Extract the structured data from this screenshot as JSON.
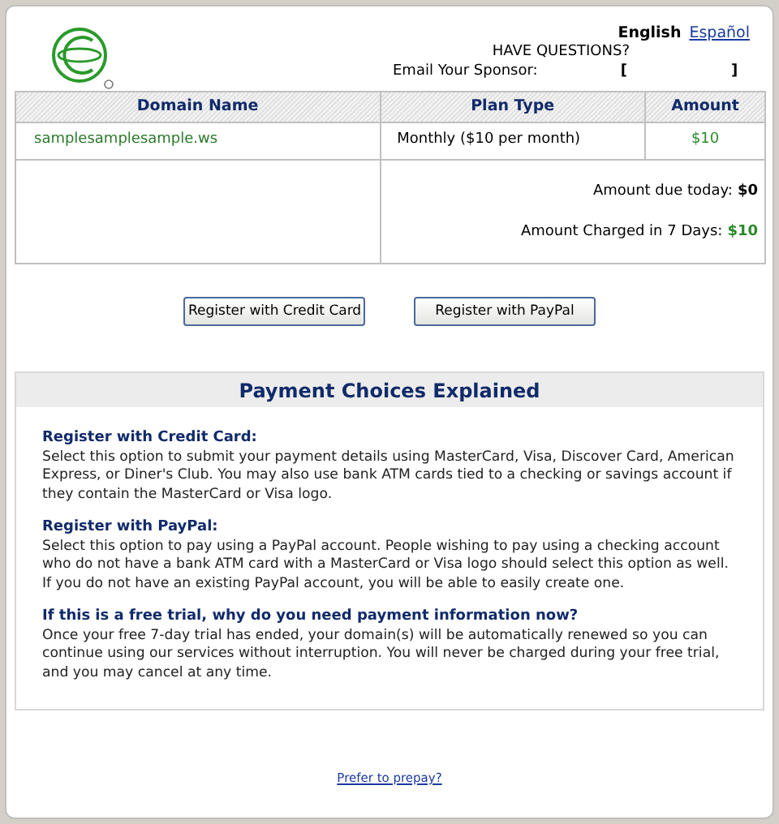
{
  "languages": [
    {
      "label": "English",
      "selected": true
    },
    {
      "label": "Español",
      "selected": false
    }
  ],
  "help": {
    "heading": "HAVE QUESTIONS?",
    "sponsor_label": "Email Your Sponsor:",
    "brackets": [
      "[",
      "]"
    ]
  },
  "table": {
    "columns": [
      "Domain Name",
      "Plan Type",
      "Amount"
    ],
    "rows": [
      {
        "domain": "samplesamplesample.ws",
        "plan": "Monthly ($10 per month)",
        "amount": "$10"
      }
    ],
    "totals": [
      {
        "label": "Amount due today:",
        "value": "$0",
        "kind": "plain"
      },
      {
        "label": "Amount Charged in 7 Days:",
        "value": "$10",
        "kind": "charge"
      }
    ]
  },
  "buttons": [
    "Register with Credit Card",
    "Register with PayPal"
  ],
  "explanation": {
    "title": "Payment Choices Explained",
    "sections": [
      {
        "heading": "Register with Credit Card:",
        "body": "Select this option to submit your payment details using MasterCard, Visa, Discover Card, American Express, or Diner's Club. You may also use bank ATM cards tied to a checking or savings account if they contain the MasterCard or Visa logo."
      },
      {
        "heading": "Register with PayPal:",
        "body": "Select this option to pay using a PayPal account. People wishing to pay using a checking account who do not have a bank ATM card with a MasterCard or Visa logo should select this option as well. If you do not have an existing PayPal account, you will be able to easily create one."
      },
      {
        "heading": "If this is a free trial, why do you need payment information now?",
        "body": "Once your free 7-day trial has ended, your domain(s) will be automatically renewed so you can continue using our services without interruption. You will never be charged during your free trial, and you may cancel at any time."
      }
    ]
  },
  "footer_link": "Prefer to prepay?"
}
